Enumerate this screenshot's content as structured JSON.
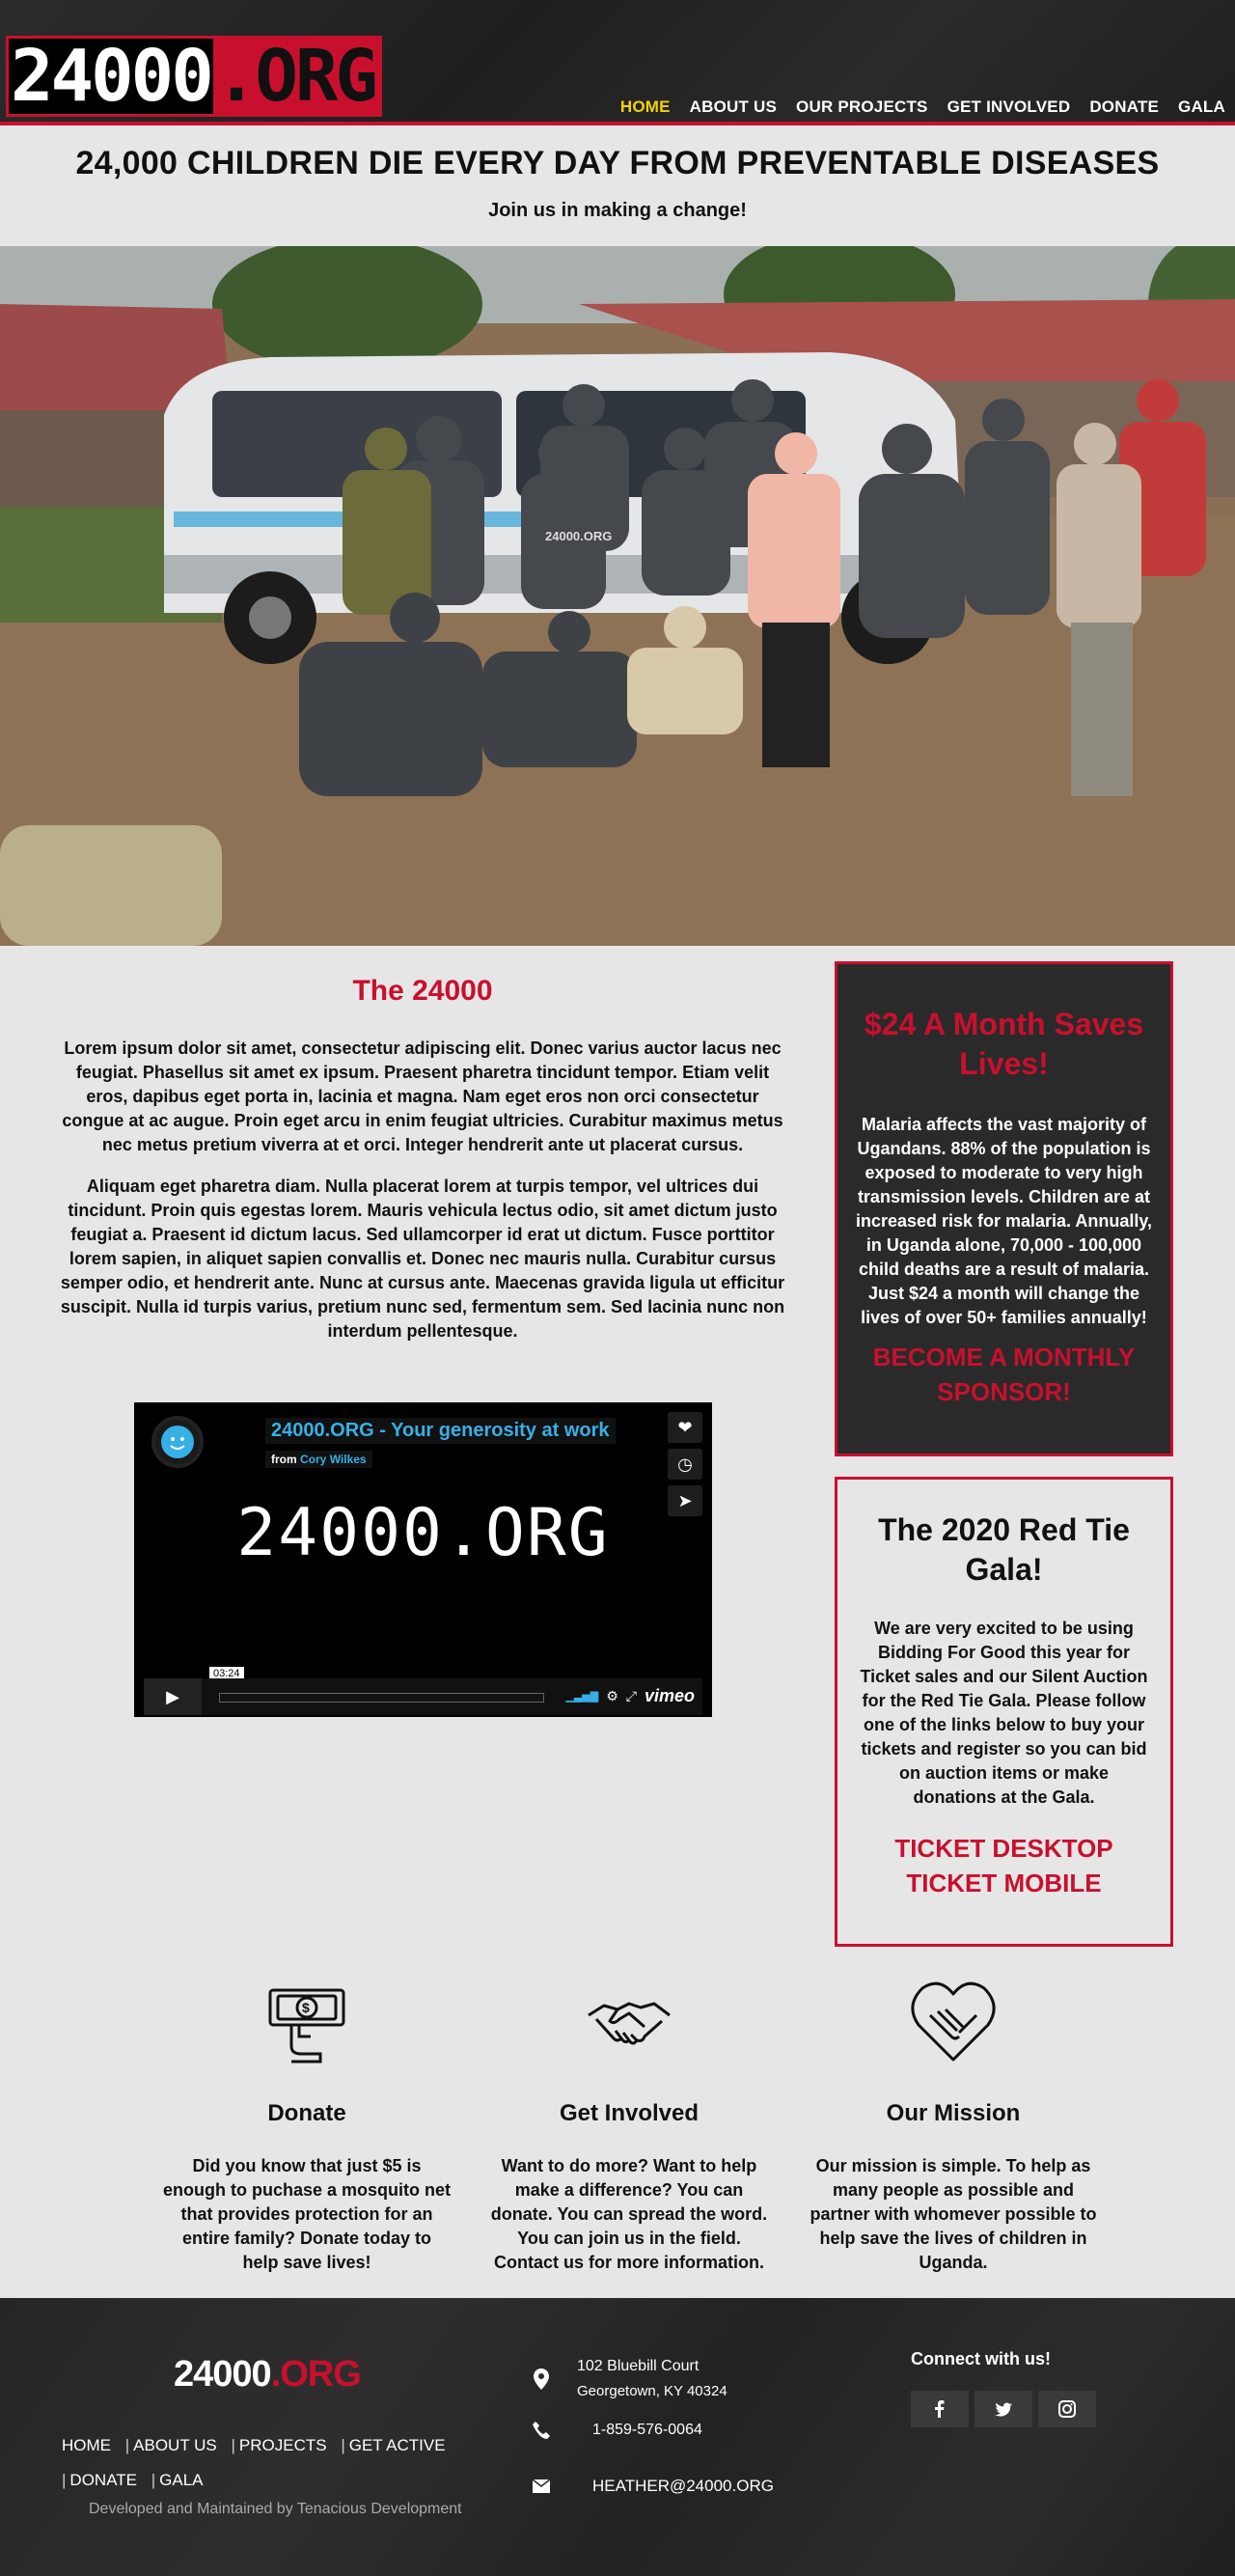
{
  "header": {
    "logo_part1": "24000",
    "logo_part2": ".ORG",
    "nav": [
      {
        "label": "HOME",
        "active": true
      },
      {
        "label": "ABOUT US"
      },
      {
        "label": "OUR PROJECTS"
      },
      {
        "label": "GET INVOLVED"
      },
      {
        "label": "DONATE"
      },
      {
        "label": "GALA"
      }
    ]
  },
  "hero": {
    "title": "24,000 CHILDREN DIE EVERY DAY FROM PREVENTABLE DISEASES",
    "subtitle": "Join us in making a change!",
    "shirt_text": "24000.ORG"
  },
  "about": {
    "title": "The 24000",
    "para1": "Lorem ipsum dolor sit amet, consectetur adipiscing elit. Donec varius auctor lacus nec feugiat. Phasellus sit amet ex ipsum. Praesent pharetra tincidunt tempor. Etiam velit eros, dapibus eget porta in, lacinia et magna. Nam eget eros non orci consectetur congue at ac augue. Proin eget arcu in enim feugiat ultricies. Curabitur maximus metus nec metus pretium viverra at et orci. Integer hendrerit ante ut placerat cursus.",
    "para2": "Aliquam eget pharetra diam. Nulla placerat lorem at turpis tempor, vel ultrices dui tincidunt. Proin quis egestas lorem. Mauris vehicula lectus odio, sit amet dictum justo feugiat a. Praesent id dictum lacus. Sed ullamcorper id erat ut dictum. Fusce porttitor lorem sapien, in aliquet sapien convallis et. Donec nec mauris nulla. Curabitur cursus semper odio, et hendrerit ante. Nunc at cursus ante. Maecenas gravida ligula ut efficitur suscipit. Nulla id turpis varius, pretium nunc sed, fermentum sem. Sed lacinia nunc non interdum pellentesque."
  },
  "video": {
    "title": "24000.ORG - Your generosity at work",
    "from_label": "from",
    "author": "Cory Wilkes",
    "big_text": "24000.ORG",
    "duration": "03:24",
    "brand": "vimeo"
  },
  "sponsor_box": {
    "title": "$24 A Month Saves Lives!",
    "text": "Malaria affects the vast majority of Ugandans. 88% of the population is exposed to moderate to very high transmission levels. Children are at increased risk for malaria. Annually, in Uganda alone, 70,000 - 100,000 child deaths are a result of malaria. Just $24 a month will change the lives of over 50+ families annually!",
    "cta": "BECOME A MONTHLY SPONSOR!"
  },
  "gala_box": {
    "title": "The 2020 Red Tie Gala!",
    "text": "We are very excited to be using Bidding For Good this year for Ticket sales and our Silent Auction for the Red Tie Gala. Please follow one of the links below to buy your tickets and register so you can bid on auction items or make donations at the Gala.",
    "link1": "TICKET DESKTOP",
    "link2": "TICKET MOBILE"
  },
  "features": [
    {
      "icon": "donate-hand-money-icon",
      "title": "Donate",
      "text": "Did you know that just $5 is enough to puchase a mosquito net that provides protection for an entire family? Donate today to help save lives!"
    },
    {
      "icon": "handshake-icon",
      "title": "Get Involved",
      "text": "Want to do more? Want to help make a difference? You can donate. You can spread the word. You can join us in the field. Contact us for more information."
    },
    {
      "icon": "heart-hands-icon",
      "title": "Our Mission",
      "text": "Our mission is simple. To help as many people as possible and partner with whomever possible to help save the lives of children in Uganda."
    }
  ],
  "footer": {
    "logo_part1": "24000",
    "logo_part2": ".ORG",
    "links": [
      "HOME",
      "ABOUT US",
      "PROJECTS",
      "GET ACTIVE",
      "DONATE",
      "GALA"
    ],
    "developer": "Developed and Maintained by Tenacious Development",
    "address_line1": "102 Bluebill Court",
    "address_line2": "Georgetown, KY 40324",
    "phone": "1-859-576-0064",
    "email": "HEATHER@24000.ORG",
    "connect": "Connect with us!",
    "social": [
      "facebook-icon",
      "twitter-icon",
      "instagram-icon"
    ]
  },
  "colors": {
    "accent": "#c8102e",
    "nav_active": "#f2d500",
    "link_blue": "#37b0e6"
  }
}
